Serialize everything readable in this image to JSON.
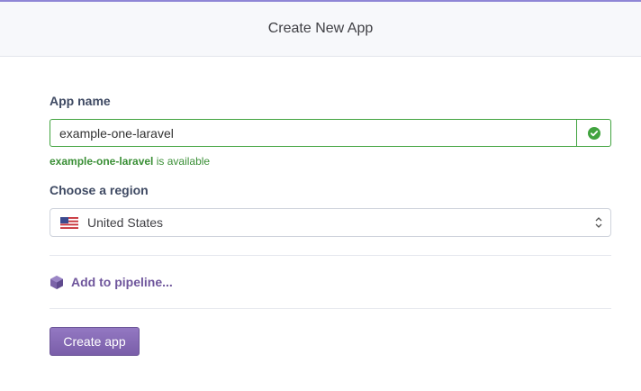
{
  "header": {
    "title": "Create New App"
  },
  "form": {
    "app_name_label": "App name",
    "app_name_value": "example-one-laravel",
    "availability": {
      "name": "example-one-laravel",
      "suffix": " is available"
    },
    "region_label": "Choose a region",
    "region_value": "United States",
    "pipeline_label": "Add to pipeline...",
    "create_button_label": "Create app"
  },
  "icons": {
    "check": "check-circle-icon",
    "flag": "us-flag-icon",
    "select": "updown-chevron-icon",
    "pipeline": "hexagon-icon"
  },
  "colors": {
    "valid_green": "#41a33f",
    "available_text": "#3a8f36",
    "accent_purple": "#7a5ea9",
    "pipeline_purple": "#6f569c",
    "header_bg": "#f7f8fb"
  }
}
